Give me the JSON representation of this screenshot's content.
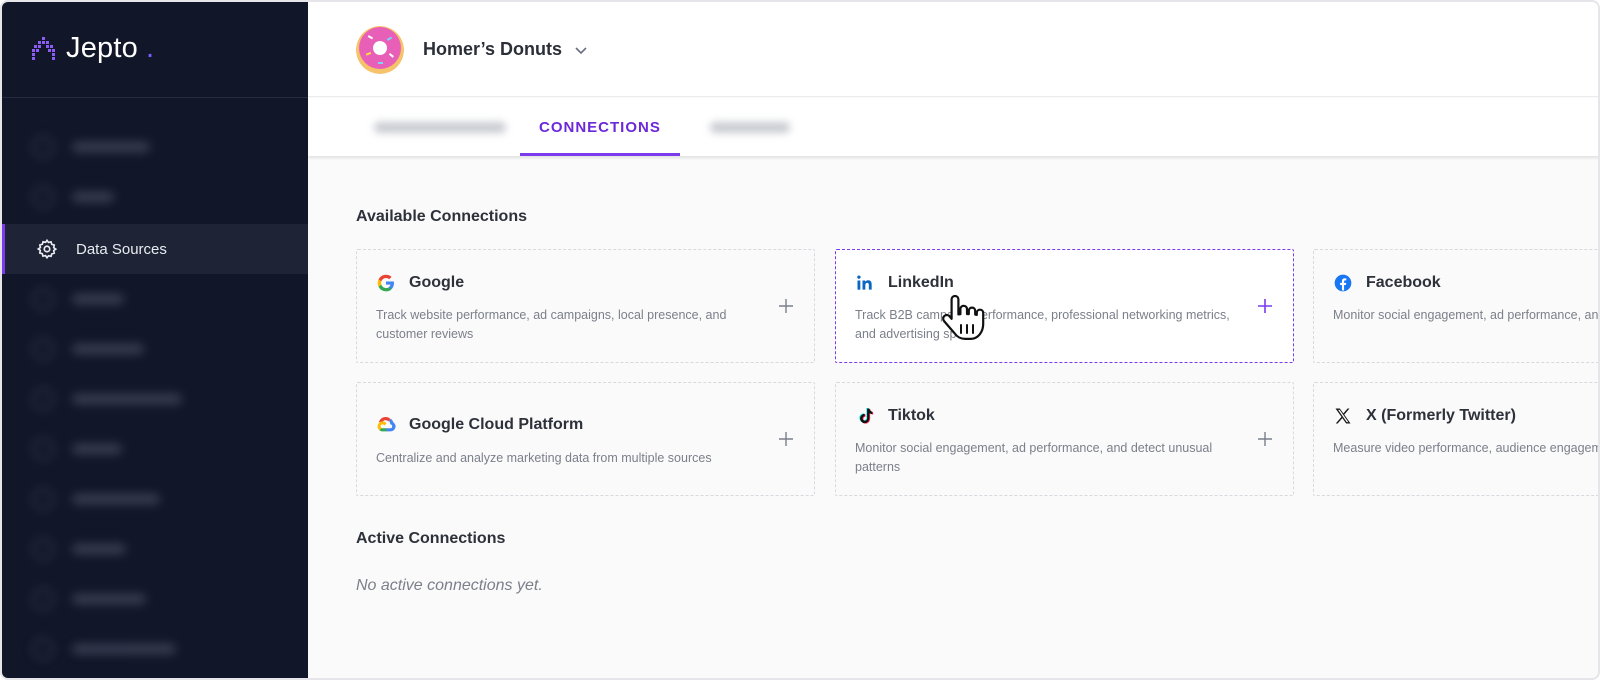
{
  "brand": {
    "name": "Jepto",
    "accent": "#7c3aed"
  },
  "sidebar": {
    "active_item": {
      "label": "Data Sources",
      "icon": "gear-icon"
    },
    "blurred_items_count_note": ""
  },
  "header": {
    "org_name": "Homer’s Donuts"
  },
  "tabs": {
    "active_label": "CONNECTIONS"
  },
  "available": {
    "title": "Available Connections",
    "cards": [
      {
        "title": "Google",
        "description": "Track website performance, ad campaigns, local presence, and customer reviews",
        "icon": "google-icon"
      },
      {
        "title": "LinkedIn",
        "description": "Track B2B campaign performance, professional networking metrics, and advertising spend",
        "icon": "linkedin-icon"
      },
      {
        "title": "Facebook",
        "description": "Monitor social engagement, ad performance, and audience across Facebook and Instagram",
        "icon": "facebook-icon"
      },
      {
        "title": "Google Cloud Platform",
        "description": "Centralize and analyze marketing data from multiple sources",
        "icon": "google-cloud-icon"
      },
      {
        "title": "Tiktok",
        "description": "Monitor social engagement, ad performance, and detect unusual patterns",
        "icon": "tiktok-icon"
      },
      {
        "title": "X (Formerly Twitter)",
        "description": "Measure video performance, audience engagement, and advertising effectiveness",
        "icon": "x-icon"
      }
    ]
  },
  "active": {
    "title": "Active Connections",
    "empty": "No active connections yet."
  }
}
